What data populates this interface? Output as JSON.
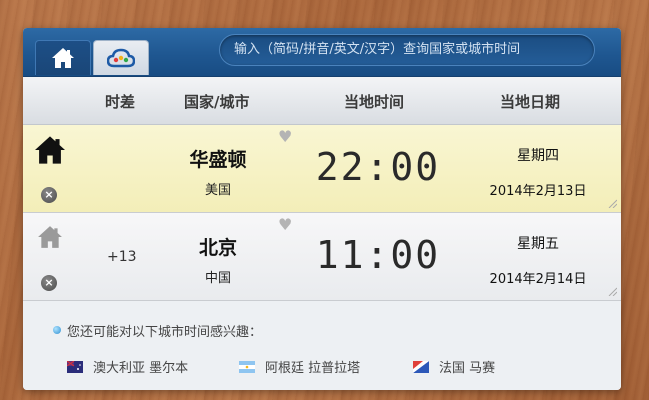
{
  "tabs": [
    {
      "name": "home-tab",
      "icon": "home-icon"
    },
    {
      "name": "cloud-tab",
      "icon": "cloud-icon"
    }
  ],
  "search": {
    "placeholder": "输入（简码/拼音/英文/汉字）查询国家或城市时间"
  },
  "header": {
    "offset": "时差",
    "country_city": "国家/城市",
    "local_time": "当地时间",
    "local_date": "当地日期"
  },
  "rows": [
    {
      "is_home": true,
      "offset": "",
      "city": "华盛顿",
      "country": "美国",
      "time": "22:00",
      "weekday": "星期四",
      "date": "2014年2月13日"
    },
    {
      "is_home": false,
      "offset": "+13",
      "city": "北京",
      "country": "中国",
      "time": "11:00",
      "weekday": "星期五",
      "date": "2014年2月14日"
    }
  ],
  "suggestions": {
    "title": "您还可能对以下城市时间感兴趣：",
    "items": [
      {
        "label": "澳大利亚 墨尔本",
        "flag": "australia-flag-icon"
      },
      {
        "label": "阿根廷 拉普拉塔",
        "flag": "argentina-flag-icon"
      },
      {
        "label": "法国 马赛",
        "flag": "france-flag-icon"
      }
    ]
  },
  "colors": {
    "topbar": "#1f5791",
    "home_row": "#f5f0c0",
    "accent_dot": "#2f8fd1"
  }
}
